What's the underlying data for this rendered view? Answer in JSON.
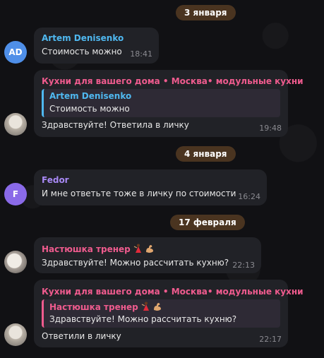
{
  "dates": {
    "d1": "3 января",
    "d2": "4 января",
    "d3": "17 февраля"
  },
  "messages": [
    {
      "avatar_initials": "AD",
      "avatar_color": "#4f8fe8",
      "sender": "Artem Denisenko",
      "sender_color": "#4fb8f0",
      "text": "Стоимость можно",
      "time": "18:41"
    },
    {
      "avatar": "photo",
      "sender": "Кухни для вашего дома • Москва• модульные кухни",
      "sender_color": "#ef5b8e",
      "reply_name": "Artem Denisenko",
      "reply_color": "#4fb8f0",
      "reply_text": "Стоимость можно",
      "text": "Здравствуйте! Ответила в личку",
      "time": "19:48"
    },
    {
      "avatar_initials": "F",
      "avatar_color": "#8a6ae8",
      "sender": "Fedor",
      "sender_color": "#a889f5",
      "text": "И мне ответьте тоже в личку по стоимости",
      "time": "16:24"
    },
    {
      "avatar": "photo",
      "sender": "Настюшка тренер",
      "sender_color": "#ef5b8e",
      "sender_emoji": [
        "dancer-emoji",
        "flexed-biceps-emoji"
      ],
      "text": "Здравствуйте! Можно рассчитать кухню?",
      "time": "22:13"
    },
    {
      "avatar": "photo",
      "sender": "Кухни для вашего дома • Москва• модульные кухни",
      "sender_color": "#ef5b8e",
      "reply_name": "Настюшка тренер",
      "reply_color": "#ef5b8e",
      "reply_text": "Здравствуйте! Можно рассчитать кухню?",
      "text": "Ответили в личку",
      "time": "22:17"
    }
  ]
}
